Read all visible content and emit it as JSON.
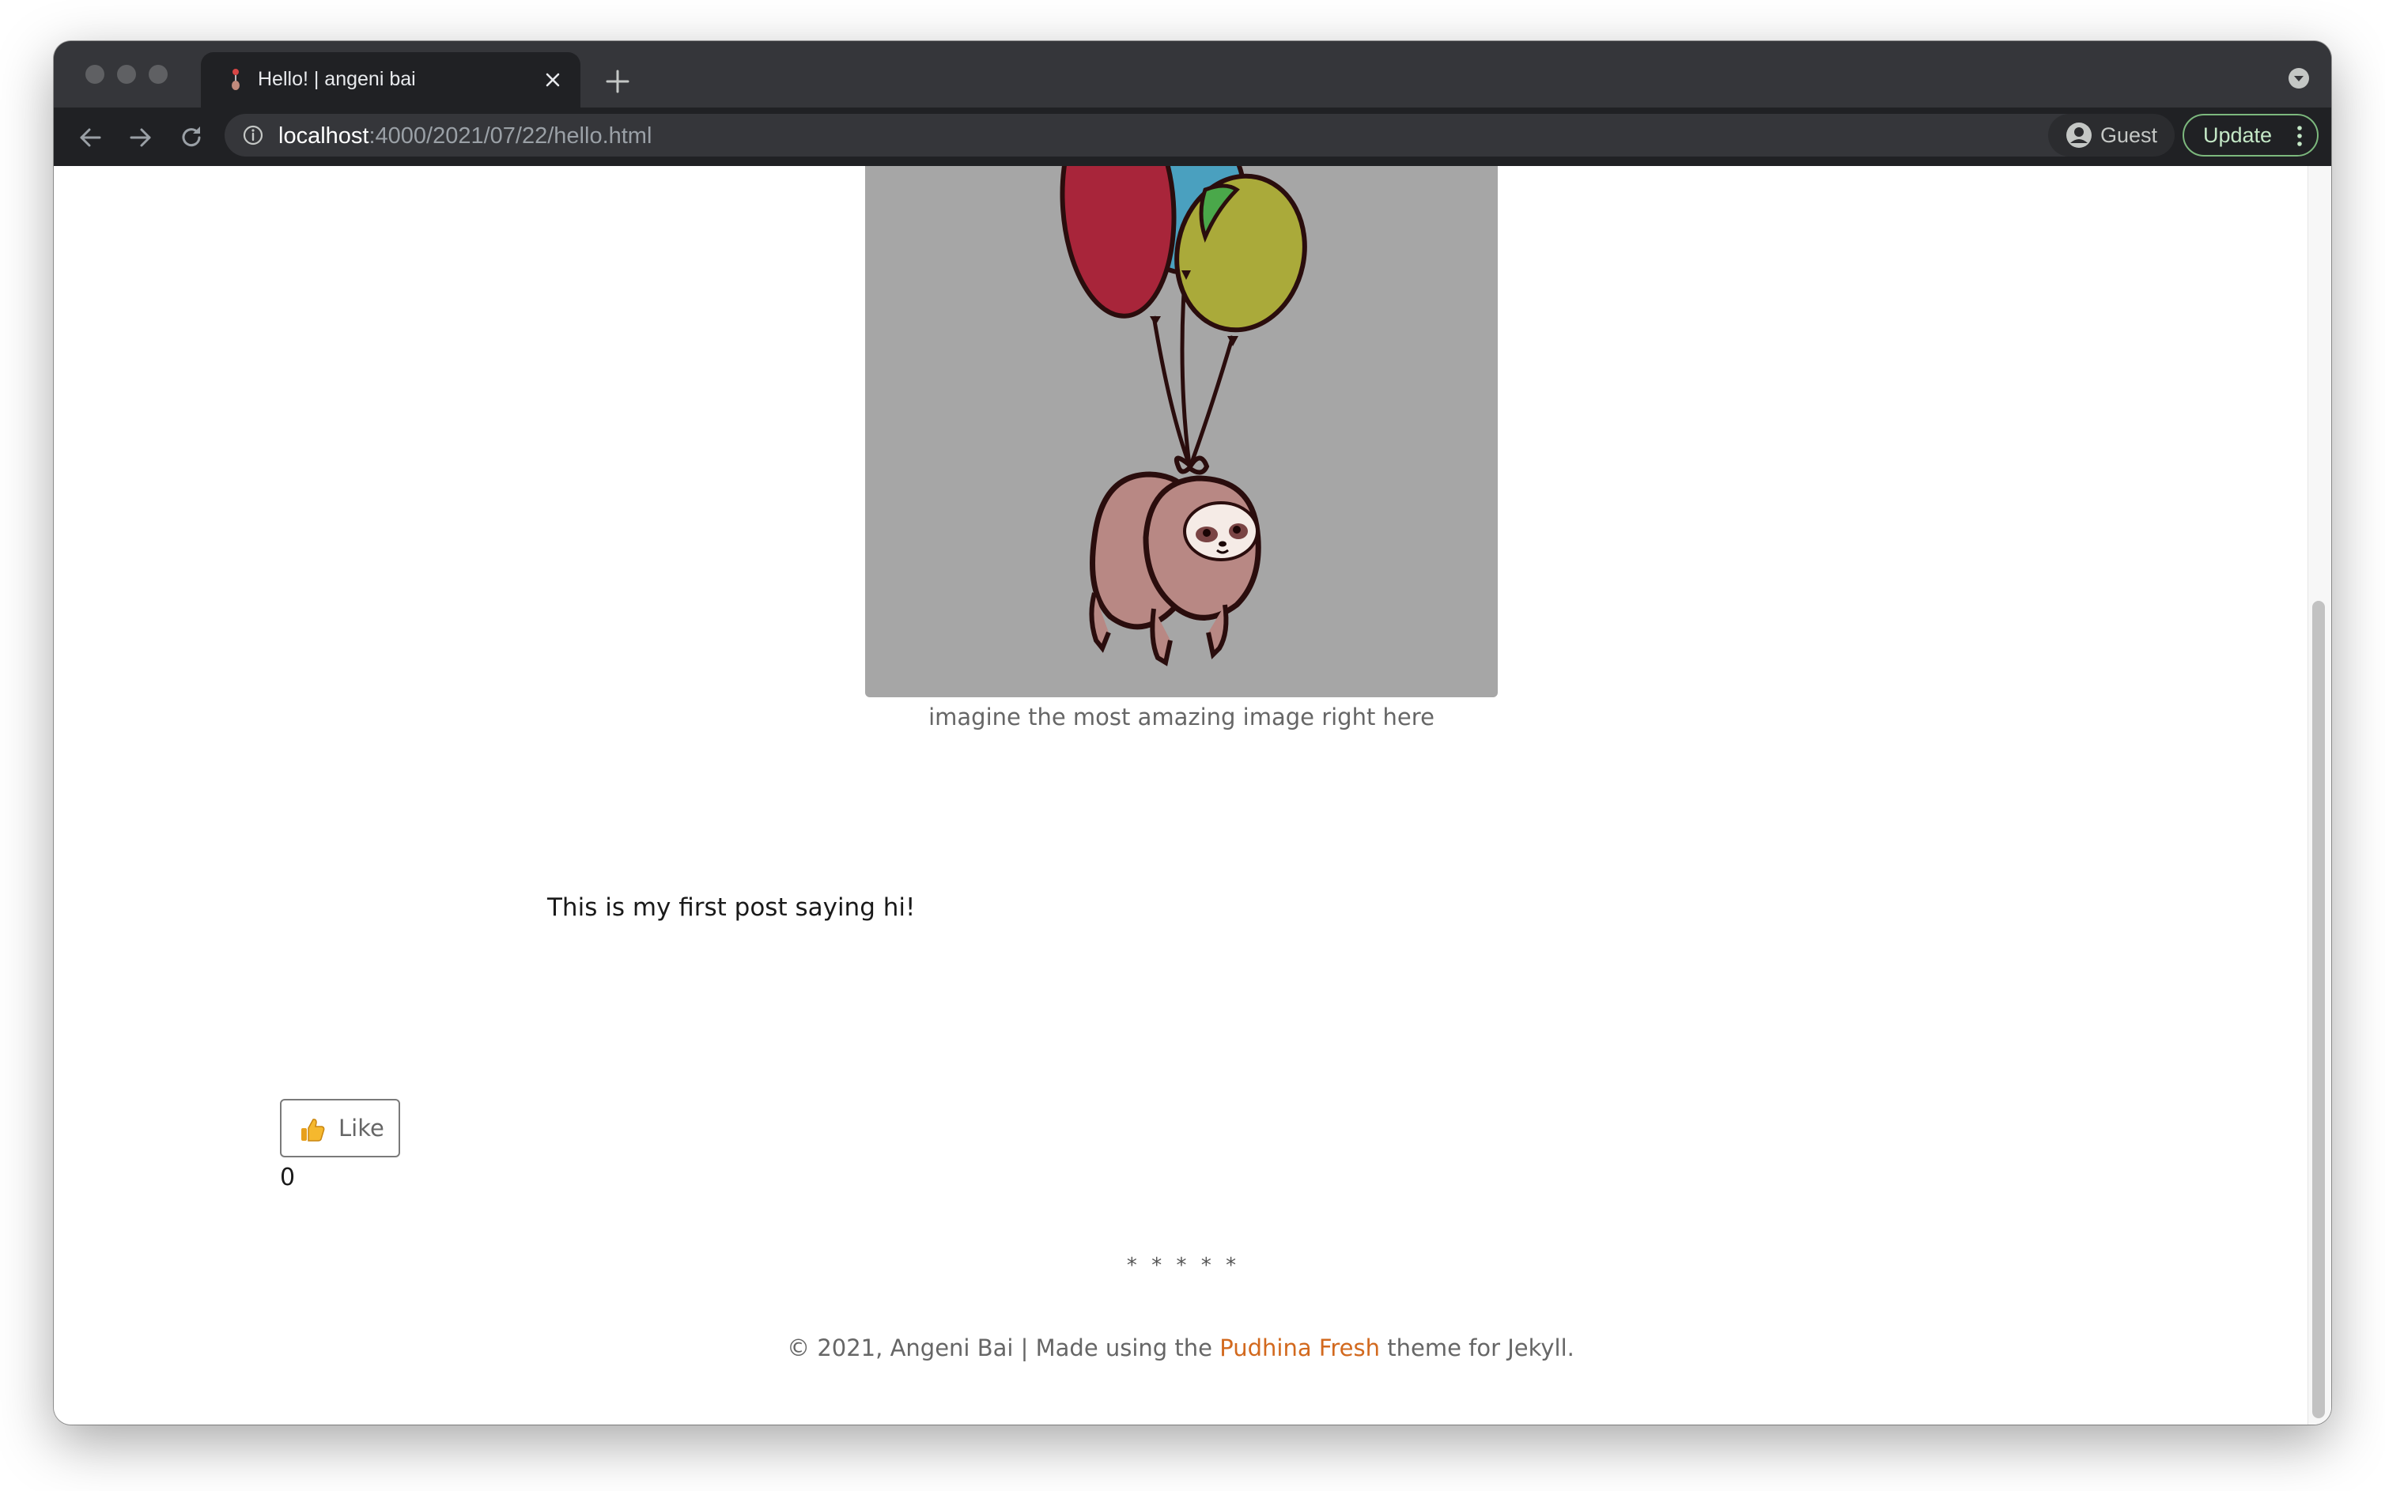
{
  "browser": {
    "tab_title": "Hello! | angeni bai",
    "url_host": "localhost",
    "url_path": ":4000/2021/07/22/hello.html",
    "profile_label": "Guest",
    "update_label": "Update"
  },
  "post": {
    "image_caption": "imagine the most amazing image right here",
    "body_text": "This is my first post saying hi!",
    "like_label": "Like",
    "like_count": "0",
    "separator": "* * * * *"
  },
  "footer": {
    "prefix": "© 2021, Angeni Bai | Made using the ",
    "theme_link": "Pudhina Fresh",
    "suffix": " theme for Jekyll."
  },
  "colors": {
    "link": "#d2691e",
    "image_background": "#a6a6a6",
    "update_border": "#7cb87d"
  },
  "icons": {
    "back": "arrow-left",
    "forward": "arrow-right",
    "reload": "reload",
    "site_info": "info-circle",
    "profile": "person-avatar",
    "like": "thumbs-up"
  }
}
